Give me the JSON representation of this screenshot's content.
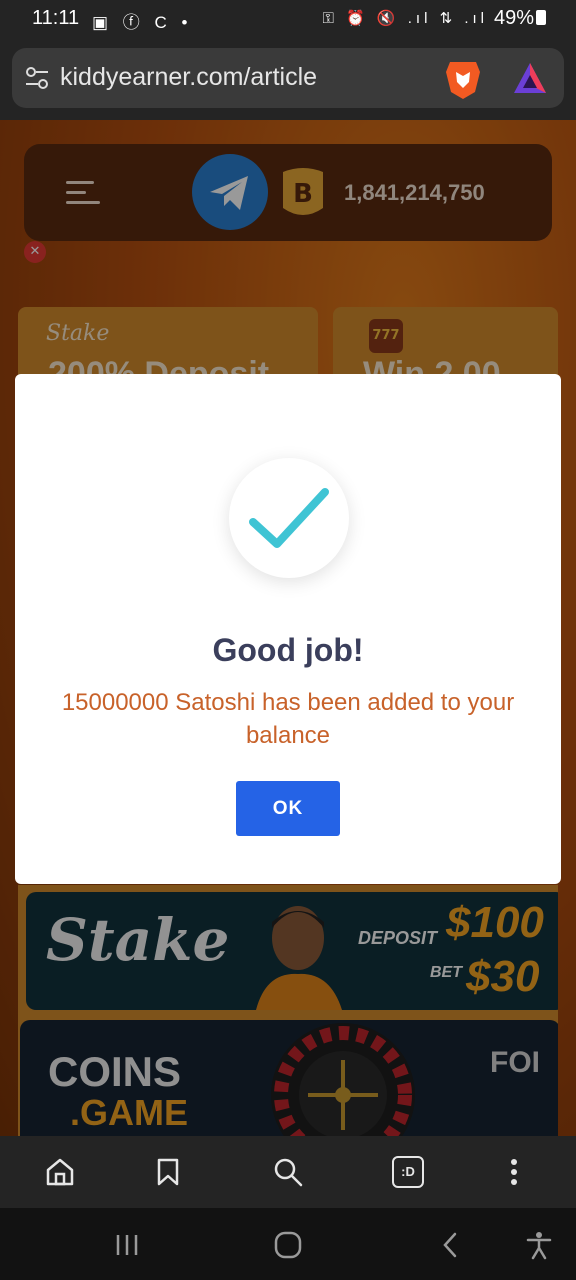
{
  "status_bar": {
    "time": "11:11",
    "left_icons": "▣ ⓕ C •",
    "right_icons": "⚿ ⏰ 🔇 .ıl ⇅ .ıl",
    "battery": "49%"
  },
  "browser": {
    "url": "kiddyearner.com/article",
    "icons": [
      "tune-icon",
      "brave-lion-icon",
      "brave-rewards-icon"
    ]
  },
  "site_header": {
    "coins": "1,841,214,750",
    "icons": [
      "hamburger-icon",
      "telegram-icon",
      "bitcoin-icon"
    ]
  },
  "ad_cards": [
    {
      "brand": "Stake",
      "text": "200% Deposit"
    },
    {
      "icon": "777",
      "text": "Win 2.00"
    }
  ],
  "banners": {
    "stake": {
      "logo": "Stake",
      "deposit_label": "DEPOSIT",
      "deposit_amount": "$100",
      "bet_label": "BET",
      "bet_amount": "$30"
    },
    "coins": {
      "logo_top": "COINS",
      "logo_bottom": ".GAME",
      "side_text": "FOI"
    }
  },
  "modal": {
    "title": "Good job!",
    "message": "15000000 Satoshi has been added to your balance",
    "ok_label": "OK"
  },
  "colors": {
    "modal_title": "#3b3f5c",
    "modal_text": "#c8622a",
    "ok_button": "#2563e6",
    "check": "#3fc4d4"
  },
  "toolbar": [
    "home-icon",
    "bookmark-icon",
    "search-icon",
    "tabs-icon",
    "more-icon"
  ],
  "tabs_label": ":D",
  "system_nav": [
    "recents-icon",
    "home-nav-icon",
    "back-icon",
    "accessibility-icon"
  ]
}
